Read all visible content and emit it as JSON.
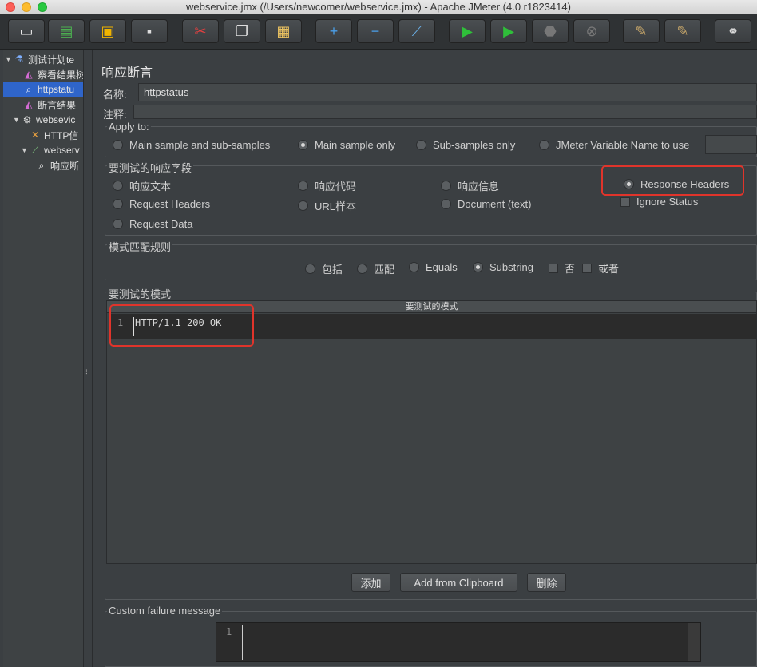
{
  "window": {
    "title": "webservice.jmx (/Users/newcomer/webservice.jmx) - Apache JMeter (4.0 r1823414)"
  },
  "toolbar": {
    "buttons": [
      "new-icon",
      "templates-icon",
      "open-icon",
      "save-icon",
      "cut-icon",
      "copy-icon",
      "paste-icon",
      "expand-icon",
      "collapse-icon",
      "toggle-icon",
      "start-icon",
      "start-no-pause-icon",
      "stop-icon",
      "shutdown-icon",
      "clear-icon",
      "clear-all-icon",
      "search-icon"
    ]
  },
  "tree": {
    "items": [
      {
        "label": "测试计划te",
        "icon": "flask-icon"
      },
      {
        "label": "察看结果树",
        "icon": "chart-icon"
      },
      {
        "label": "httpstatu",
        "icon": "magnifier-icon"
      },
      {
        "label": "断言结果",
        "icon": "chart-icon"
      },
      {
        "label": "websevic",
        "icon": "gear-icon"
      },
      {
        "label": "HTTP信",
        "icon": "tools-icon"
      },
      {
        "label": "webserv",
        "icon": "pipette-icon"
      },
      {
        "label": "响应断",
        "icon": "magnifier-icon"
      }
    ]
  },
  "panel": {
    "title": "响应断言",
    "name_label": "名称:",
    "name_value": "httpstatus",
    "comment_label": "注释:",
    "comment_value": ""
  },
  "apply_to": {
    "title": "Apply to:",
    "options": [
      "Main sample and sub-samples",
      "Main sample only",
      "Sub-samples only",
      "JMeter Variable Name to use"
    ],
    "selected": "Main sample only",
    "variable_value": ""
  },
  "response_field": {
    "title": "要测试的响应字段",
    "options": [
      "响应文本",
      "响应代码",
      "响应信息",
      "Response Headers",
      "Request Headers",
      "URL样本",
      "Document (text)",
      "Request Data"
    ],
    "selected": "Response Headers",
    "ignore_status_label": "Ignore Status",
    "ignore_status_checked": false
  },
  "matching_rules": {
    "title": "模式匹配规则",
    "options": [
      "包括",
      "匹配",
      "Equals",
      "Substring"
    ],
    "selected": "Substring",
    "not_label": "否",
    "or_label": "或者",
    "not_checked": false,
    "or_checked": false
  },
  "patterns": {
    "title": "要测试的模式",
    "column_header": "要测试的模式",
    "rows": [
      {
        "line": "1",
        "value": "HTTP/1.1 200 OK"
      }
    ]
  },
  "buttons": {
    "add": "添加",
    "add_clipboard": "Add from Clipboard",
    "delete": "删除"
  },
  "custom_failure": {
    "title": "Custom failure message",
    "line": "1",
    "value": ""
  },
  "colors": {
    "highlight": "#e0342b",
    "selection": "#2f65ca",
    "background": "#3b3f42"
  }
}
